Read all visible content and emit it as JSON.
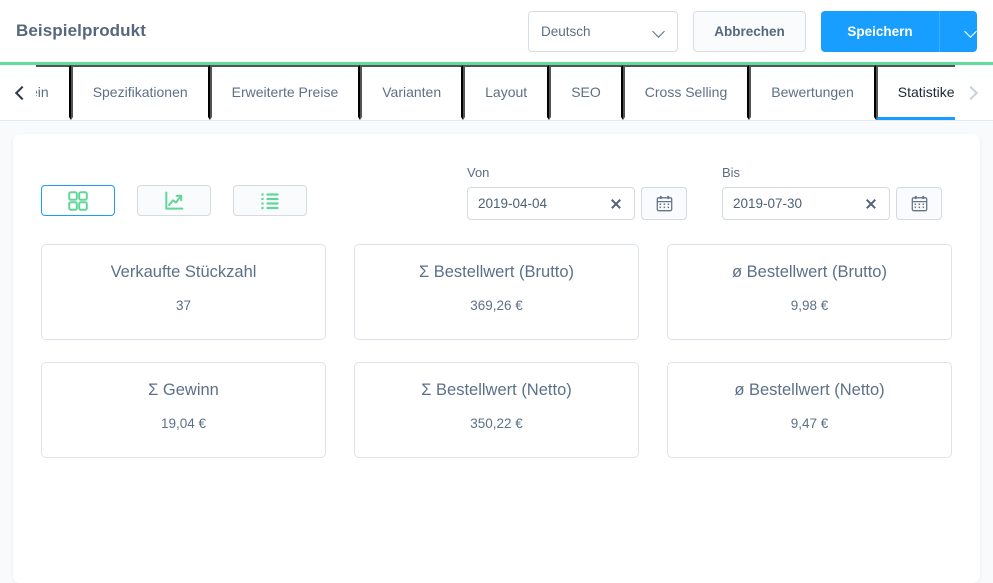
{
  "header": {
    "title": "Beispielprodukt",
    "language_select": {
      "value": "Deutsch",
      "icon": "chevron-down-icon"
    },
    "cancel_label": "Abbrechen",
    "save_label": "Speichern",
    "save_caret_icon": "chevron-down-icon",
    "accent_color": "#62dc9b"
  },
  "tabs": {
    "scroll_left_icon": "chevron-left-icon",
    "scroll_right_icon": "chevron-right-icon",
    "items": [
      {
        "label": "ein",
        "active": false
      },
      {
        "label": "Spezifikationen",
        "active": false
      },
      {
        "label": "Erweiterte Preise",
        "active": false
      },
      {
        "label": "Varianten",
        "active": false
      },
      {
        "label": "Layout",
        "active": false
      },
      {
        "label": "SEO",
        "active": false
      },
      {
        "label": "Cross Selling",
        "active": false
      },
      {
        "label": "Bewertungen",
        "active": false
      },
      {
        "label": "Statistiken",
        "active": true
      }
    ],
    "active_color": "#189eff"
  },
  "toolbar": {
    "view_modes": [
      {
        "name": "grid-view",
        "icon": "grid-icon",
        "active": true
      },
      {
        "name": "chart-view",
        "icon": "line-chart-icon",
        "active": false
      },
      {
        "name": "list-view",
        "icon": "list-icon",
        "active": false
      }
    ],
    "icon_color": "#62d69a",
    "date_from": {
      "label": "Von",
      "value": "2019-04-04",
      "clear_icon": "close-icon",
      "calendar_icon": "calendar-icon"
    },
    "date_to": {
      "label": "Bis",
      "value": "2019-07-30",
      "clear_icon": "close-icon",
      "calendar_icon": "calendar-icon"
    }
  },
  "stats": [
    {
      "title": "Verkaufte Stückzahl",
      "value": "37"
    },
    {
      "title": "Σ Bestellwert (Brutto)",
      "value": "369,26 €"
    },
    {
      "title": "ø Bestellwert (Brutto)",
      "value": "9,98 €"
    },
    {
      "title": "Σ Gewinn",
      "value": "19,04 €"
    },
    {
      "title": "Σ Bestellwert (Netto)",
      "value": "350,22 €"
    },
    {
      "title": "ø Bestellwert (Netto)",
      "value": "9,47 €"
    }
  ]
}
